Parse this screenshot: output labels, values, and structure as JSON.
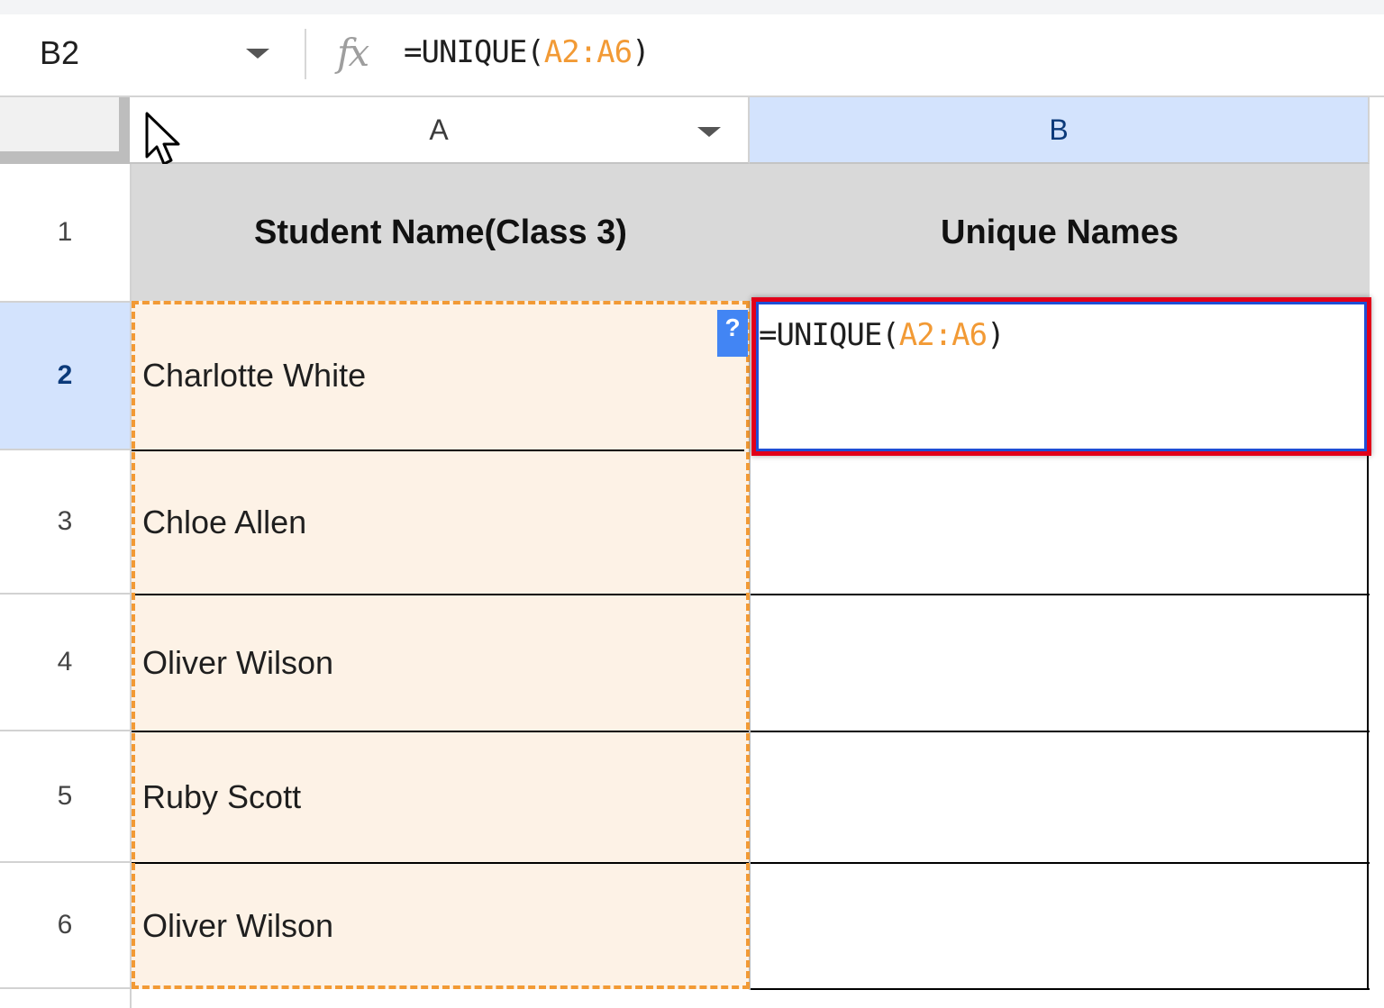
{
  "formula_bar": {
    "name_box": "B2",
    "fx_label": "fx",
    "formula_prefix": "=UNIQUE(",
    "formula_ref": "A2:A6",
    "formula_suffix": ")"
  },
  "columns": [
    {
      "label": "A"
    },
    {
      "label": "B"
    }
  ],
  "rows": [
    {
      "label": "1"
    },
    {
      "label": "2"
    },
    {
      "label": "3"
    },
    {
      "label": "4"
    },
    {
      "label": "5"
    },
    {
      "label": "6"
    }
  ],
  "cells": {
    "a1": "Student Name(Class 3)",
    "b1": "Unique Names",
    "a2": "Charlotte White",
    "a3": "Chloe Allen",
    "a4": "Oliver Wilson",
    "a5": "Ruby Scott",
    "a6": "Oliver Wilson"
  },
  "active_cell": {
    "formula_prefix": "=UNIQUE(",
    "formula_ref": "A2:A6",
    "formula_suffix": ")",
    "help_badge": "?"
  },
  "colors": {
    "range_highlight": "#f29a35",
    "active_border": "#e1001a",
    "selection_header": "#d3e3fd"
  }
}
